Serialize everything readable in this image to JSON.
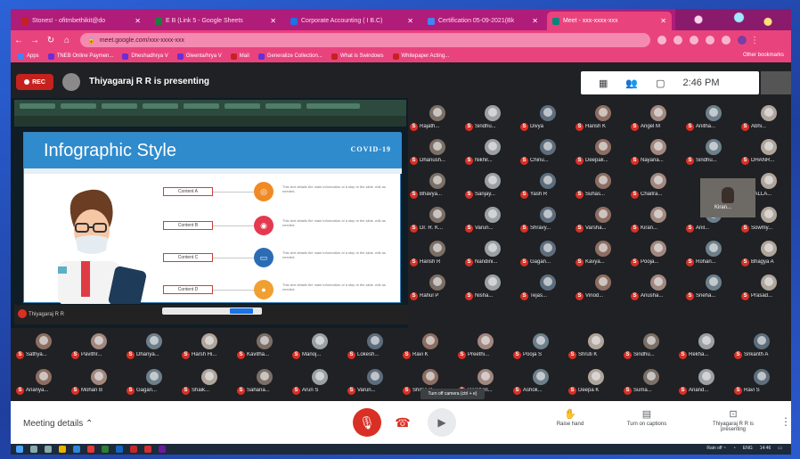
{
  "browser": {
    "tabs": [
      {
        "label": "Stones! - ofitmbethikit@do",
        "color": "#c5221f"
      },
      {
        "label": "E B (Link 5 - Google Sheets",
        "color": "#188038"
      },
      {
        "label": "Corporate Accounting ( I B.C)",
        "color": "#1a73e8"
      },
      {
        "label": "Certification 05-09-2021(Bk",
        "color": "#4285f4"
      },
      {
        "label": "Meet - xxx-xxxx-xxx",
        "color": "#00897b"
      }
    ],
    "url": "meet.google.com/xxx-xxxx-xxx",
    "bookmarks": [
      "Apps",
      "TNEB Online Paymen...",
      "Dheshadhrya V",
      "Gleenta/hrya V",
      "Mail",
      "Generalize Collection...",
      "What is Swindows",
      "Whitepaper Acting..."
    ],
    "other_bookmarks": "Other bookmarks"
  },
  "meet": {
    "rec_label": "REC",
    "presenting_text": "Thiyagaraj R R is presenting",
    "time": "2:46 PM",
    "meeting_details": "Meeting details",
    "tooltip": "Turn off camera (ctrl + e)",
    "raise_hand": "Raise hand",
    "captions": "Turn on captions",
    "presenting_ctrl": "Thiyagaraj R R is presenting"
  },
  "slide": {
    "title": "Infographic Style",
    "tag": "COVID-19",
    "contents": [
      {
        "label": "Content A",
        "color": "#f08a24",
        "text": "This text details the main information of a step in the slide, edit as needed."
      },
      {
        "label": "Content B",
        "color": "#e53950",
        "text": "This text details the main information of a step in the slide, edit as needed."
      },
      {
        "label": "Content C",
        "color": "#2b6cb5",
        "text": "This text details the main information of a step in the slide, edit as needed."
      },
      {
        "label": "Content D",
        "color": "#f0a030",
        "text": "This text details the main information of a step in the slide, edit as needed."
      }
    ],
    "presenter_footer": "Thiyagaraj R R"
  },
  "participants_top": [
    "Rajath...",
    "Sindhu...",
    "Divya",
    "Harish K",
    "Angel M",
    "Anitha...",
    "Abhi...",
    "Dhanush...",
    "Nikhil...",
    "Chinu...",
    "Deepak...",
    "Nayana...",
    "Sindhu...",
    "DHANR...",
    "Bhavya...",
    "Sanjay...",
    "Yash R",
    "Suhas...",
    "Chaitra...",
    "",
    "PALLA...",
    "Dr. R. K...",
    "Varun...",
    "Shravy...",
    "Varsha...",
    "Kiran...",
    "Anil...",
    "Sowmy...",
    "Harish R",
    "Nandini...",
    "Gagan...",
    "Kavya...",
    "Pooja...",
    "Rohan...",
    "Bhagya A",
    "Rahul P",
    "Nisha...",
    "Tejas...",
    "Vinod...",
    "Anusha...",
    "Sneha...",
    "Prasad..."
  ],
  "participants_bottom": [
    "Sathya...",
    "Pavithr...",
    "Dhanya...",
    "Harsh Hi...",
    "Kavitha...",
    "Manoj...",
    "Lokesh...",
    "Ravi K",
    "Preethi...",
    "Pooja S",
    "Shruti K",
    "Sindhu...",
    "Rekha...",
    "Srikanth A",
    "Ananya...",
    "Mohan B",
    "Gagan...",
    "Shaik...",
    "Sahana...",
    "Arun S",
    "Varun...",
    "Shilpa B",
    "Darshan...",
    "Ashok...",
    "Deepa K",
    "Suma...",
    "Anand...",
    "Ravi S"
  ],
  "cam_tile_name": "Kiran...",
  "taskbar": {
    "weather": "Rain off ~",
    "lang": "ENG",
    "clock": "14:46"
  }
}
